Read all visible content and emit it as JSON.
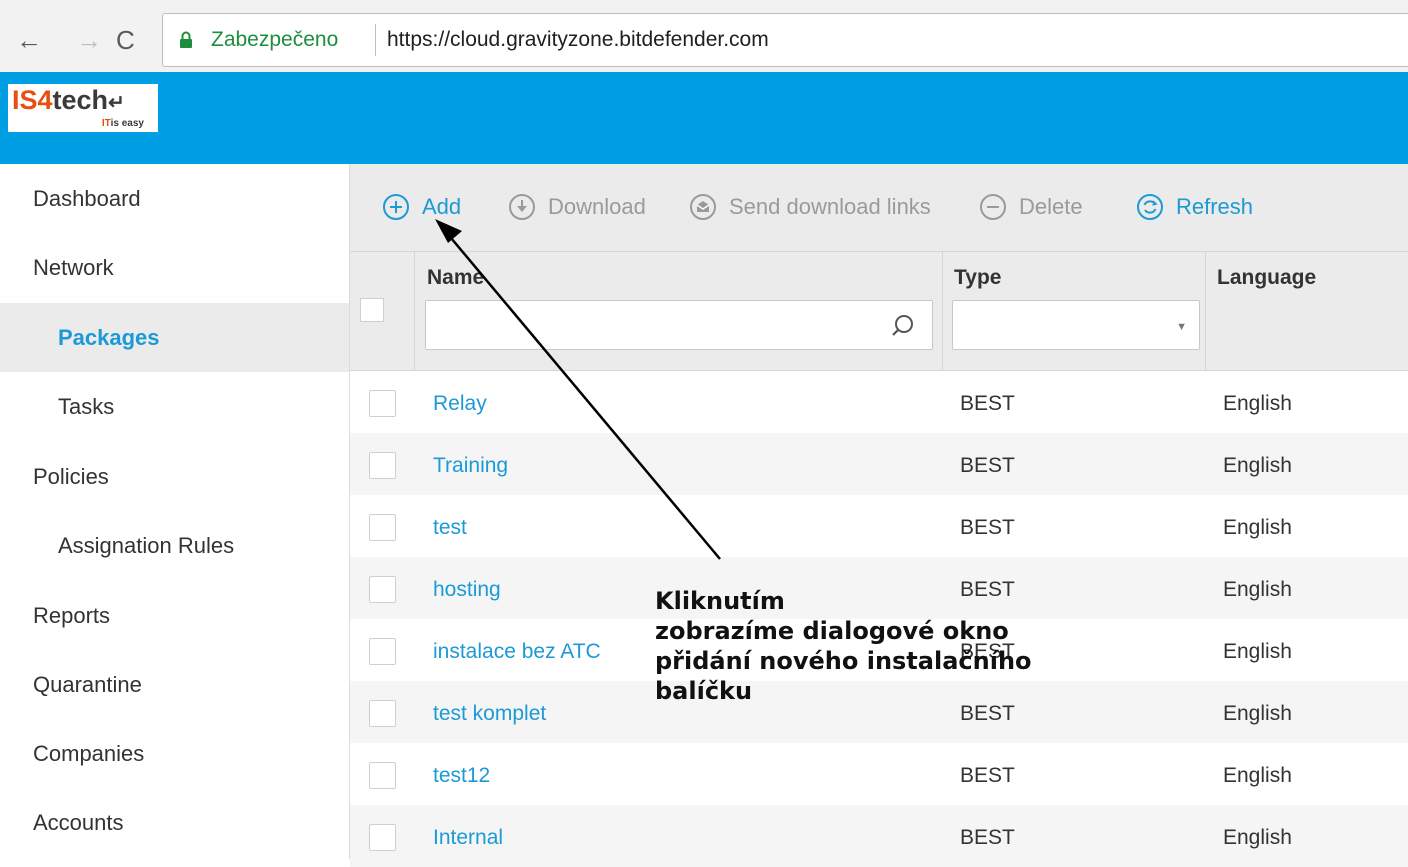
{
  "browser": {
    "secure_label": "Zabezpečeno",
    "url": "https://cloud.gravityzone.bitdefender.com"
  },
  "logo": {
    "part1": "IS4",
    "part2": "tech",
    "sub1": "IT",
    "sub2": "is easy"
  },
  "sidebar": {
    "items": [
      {
        "label": "Dashboard",
        "level": 1
      },
      {
        "label": "Network",
        "level": 1
      },
      {
        "label": "Packages",
        "level": 2,
        "active": true
      },
      {
        "label": "Tasks",
        "level": 2
      },
      {
        "label": "Policies",
        "level": 1
      },
      {
        "label": "Assignation Rules",
        "level": 2
      },
      {
        "label": "Reports",
        "level": 1
      },
      {
        "label": "Quarantine",
        "level": 1
      },
      {
        "label": "Companies",
        "level": 1
      },
      {
        "label": "Accounts",
        "level": 1
      }
    ]
  },
  "toolbar": {
    "add": "Add",
    "download": "Download",
    "send_links": "Send download links",
    "delete": "Delete",
    "refresh": "Refresh"
  },
  "table": {
    "columns": {
      "name": "Name",
      "type": "Type",
      "language": "Language"
    },
    "filters": {
      "name": "",
      "type": ""
    },
    "rows": [
      {
        "name": "Relay",
        "type": "BEST",
        "language": "English"
      },
      {
        "name": "Training",
        "type": "BEST",
        "language": "English"
      },
      {
        "name": "test",
        "type": "BEST",
        "language": "English"
      },
      {
        "name": "hosting",
        "type": "BEST",
        "language": "English"
      },
      {
        "name": "instalace bez ATC",
        "type": "BEST",
        "language": "English"
      },
      {
        "name": "test komplet",
        "type": "BEST",
        "language": "English"
      },
      {
        "name": "test12",
        "type": "BEST",
        "language": "English"
      },
      {
        "name": "Internal",
        "type": "BEST",
        "language": "English"
      }
    ]
  },
  "annotation": {
    "lines": [
      "Kliknutím",
      "zobrazíme dialogové okno",
      "přidání nového instalačního",
      "balíčku"
    ]
  },
  "colors": {
    "header_blue": "#009fe3",
    "link_blue": "#1c9ad6",
    "secure_green": "#1e8e3e",
    "logo_orange": "#e84e0f"
  }
}
